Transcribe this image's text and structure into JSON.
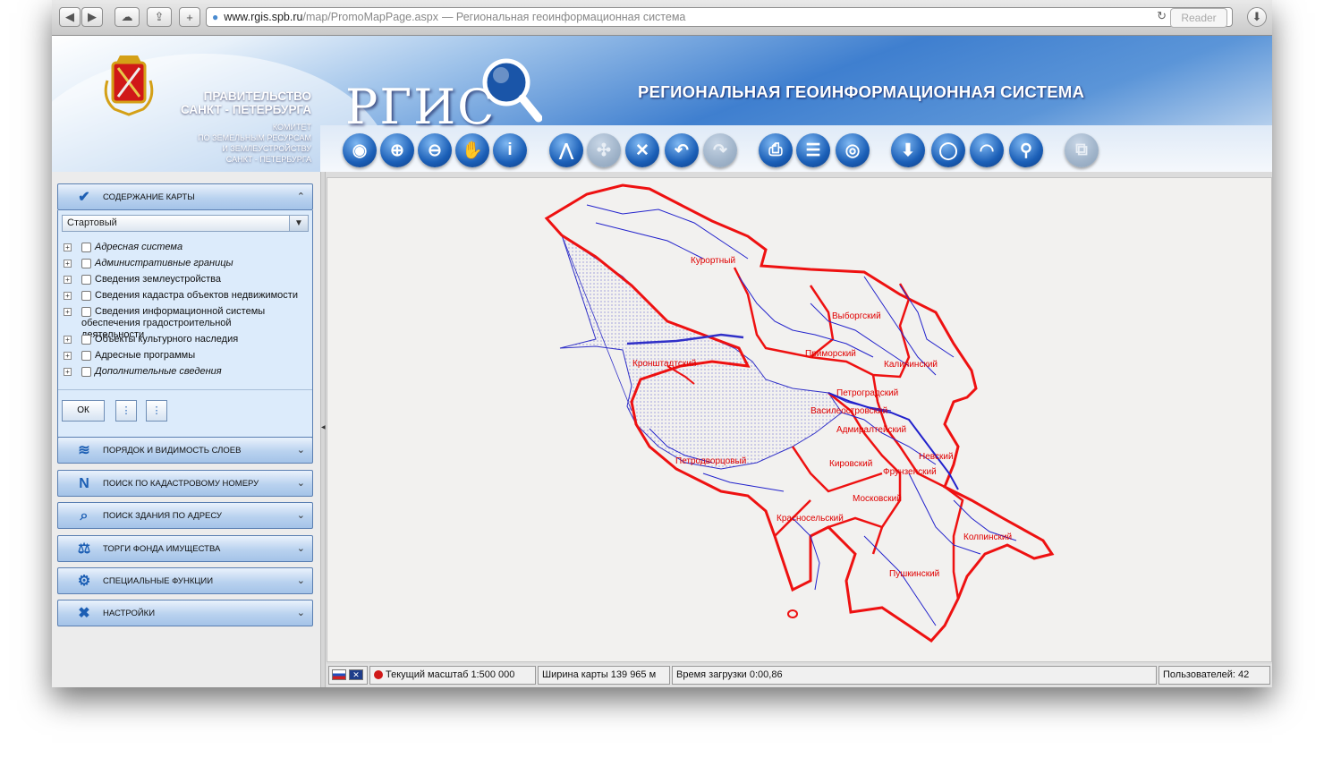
{
  "browser": {
    "url_host": "www.rgis.spb.ru",
    "url_path": "/map/PromoMapPage.aspx",
    "page_title": "— Региональная геоинформационная система",
    "reader_label": "Reader"
  },
  "header": {
    "gov_line1": "ПРАВИТЕЛЬСТВО",
    "gov_line2": "САНКТ - ПЕТЕРБУРГА",
    "committee_line1": "КОМИТЕТ",
    "committee_line2": "ПО ЗЕМЕЛЬНЫМ РЕСУРСАМ",
    "committee_line3": "И ЗЕМЛЕУСТРОЙСТВУ",
    "committee_line4": "САНКТ - ПЕТЕРБУРГА",
    "logo_text": "РГИС",
    "app_title": "РЕГИОНАЛЬНАЯ  ГЕОИНФОРМАЦИОННАЯ СИСТЕМА"
  },
  "toolbar_icons": [
    "globe-icon",
    "zoom-in-icon",
    "zoom-out-icon",
    "pan-hand-icon",
    "info-icon",
    "measure-icon",
    "select-icon",
    "clear-icon",
    "back-icon",
    "forward-icon",
    "print-icon",
    "legend-list-icon",
    "overview-globe-icon",
    "download-icon",
    "comment-icon",
    "rss-icon",
    "placemark-icon",
    "export-icon"
  ],
  "sidebar": {
    "content_section": {
      "title": "СОДЕРЖАНИЕ КАРТЫ",
      "preset_value": "Стартовый",
      "layers": [
        {
          "label": "Адресная система"
        },
        {
          "label": "Административные границы"
        },
        {
          "label": "Сведения землеустройства"
        },
        {
          "label": "Сведения кадастра объектов недвижимости"
        },
        {
          "label": "Сведения информационной системы обеспечения градостроительной деятельности"
        },
        {
          "label": "Объекты культурного наследия"
        },
        {
          "label": "Адресные программы"
        },
        {
          "label": "Дополнительные сведения"
        }
      ],
      "ok_label": "ОК"
    },
    "sections": [
      {
        "title": "ПОРЯДОК И ВИДИМОСТЬ СЛОЕВ"
      },
      {
        "title": "ПОИСК ПО КАДАСТРОВОМУ НОМЕРУ"
      },
      {
        "title": "ПОИСК ЗДАНИЯ ПО АДРЕСУ"
      },
      {
        "title": "ТОРГИ ФОНДА ИМУЩЕСТВА"
      },
      {
        "title": "СПЕЦИАЛЬНЫЕ ФУНКЦИИ"
      },
      {
        "title": "НАСТРОЙКИ"
      }
    ]
  },
  "map": {
    "districts": [
      "Курортный",
      "Выборгский",
      "Приморский",
      "Калининский",
      "Кронштадтский",
      "Петроградский",
      "Василеостровский",
      "Адмиралтейский",
      "Невский",
      "Петродворцовый",
      "Кировский",
      "Фрунзенский",
      "Московский",
      "Красносельский",
      "Колпинский",
      "Пушкинский"
    ],
    "colors": {
      "boundary": "#ee1111",
      "water": "#2222cc"
    }
  },
  "status": {
    "scale": "Текущий масштаб 1:500 000",
    "width": "Ширина карты 139 965 м",
    "load_time": "Время загрузки 0:00,86",
    "users": "Пользователей: 42"
  }
}
